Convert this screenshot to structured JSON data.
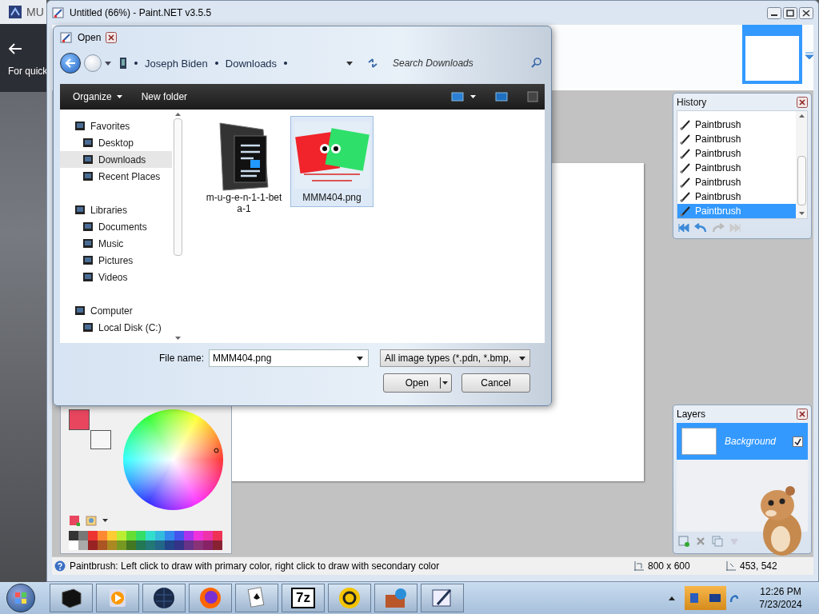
{
  "background_window": {
    "title": "MU",
    "text": "For quick"
  },
  "app": {
    "title": "Untitled (66%) - Paint.NET v3.5.5"
  },
  "history": {
    "title": "History",
    "items": [
      {
        "label": "Paintbrush",
        "selected": false
      },
      {
        "label": "Paintbrush",
        "selected": false
      },
      {
        "label": "Paintbrush",
        "selected": false
      },
      {
        "label": "Paintbrush",
        "selected": false
      },
      {
        "label": "Paintbrush",
        "selected": false
      },
      {
        "label": "Paintbrush",
        "selected": false
      },
      {
        "label": "Paintbrush",
        "selected": true
      }
    ]
  },
  "layers": {
    "title": "Layers",
    "items": [
      {
        "name": "Background",
        "visible": true,
        "selected": true
      }
    ]
  },
  "status_bar": {
    "text": "Paintbrush: Left click to draw with primary color, right click to draw with secondary color",
    "image_size": "800 x 600",
    "cursor_position": "453, 542"
  },
  "dialog": {
    "title": "Open",
    "breadcrumb": [
      "Joseph Biden",
      "Downloads"
    ],
    "search": {
      "placeholder": "Search Downloads"
    },
    "toolbar": [
      "Organize",
      "New folder"
    ],
    "navigation": [
      {
        "label": "Favorites",
        "selected": false,
        "children": [
          {
            "label": "Desktop",
            "selected": false
          },
          {
            "label": "Downloads",
            "selected": true
          },
          {
            "label": "Recent Places",
            "selected": false
          }
        ]
      },
      {
        "label": "Libraries",
        "selected": false,
        "children": [
          {
            "label": "Documents",
            "selected": false
          },
          {
            "label": "Music",
            "selected": false
          },
          {
            "label": "Pictures",
            "selected": false
          },
          {
            "label": "Videos",
            "selected": false
          }
        ]
      },
      {
        "label": "Computer",
        "selected": false,
        "children": [
          {
            "label": "Local Disk (C:)",
            "selected": false
          }
        ]
      }
    ],
    "files": [
      {
        "name": "m-u-g-e-n-1-1-beta-1",
        "kind": "folder",
        "selected": false
      },
      {
        "name": "MMM404.png",
        "kind": "image",
        "selected": true
      }
    ],
    "file_name": {
      "label": "File name:",
      "value": "MMM404.png"
    },
    "file_type": "All image types (*.pdn, *.bmp,",
    "buttons": [
      {
        "label": "Open",
        "kind": "split"
      },
      {
        "label": "Cancel",
        "kind": "plain"
      }
    ]
  },
  "taskbar": {
    "archive_label": "7z",
    "time": "12:26 PM",
    "date": "7/23/2024"
  }
}
